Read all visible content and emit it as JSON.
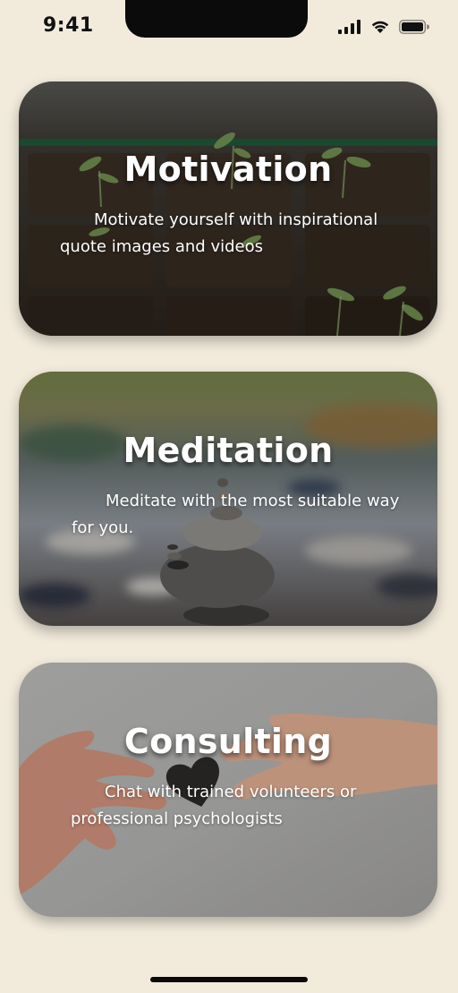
{
  "status_bar": {
    "time": "9:41"
  },
  "cards": [
    {
      "title": "Motivation",
      "description": "Motivate yourself with inspirational quote images and videos",
      "image": "seedlings-in-soil-tray-photo"
    },
    {
      "title": "Meditation",
      "description": "Meditate with the most suitable way for you.",
      "image": "stacked-stones-by-river-photo"
    },
    {
      "title": "Consulting",
      "description": "Chat with trained volunteers or professional psychologists",
      "image": "hands-passing-heart-photo"
    }
  ],
  "icons": {
    "signal": "cellular-signal-icon",
    "wifi": "wifi-icon",
    "battery": "battery-icon"
  },
  "colors": {
    "background": "#f2ebdc",
    "text_on_card": "#ffffff"
  }
}
